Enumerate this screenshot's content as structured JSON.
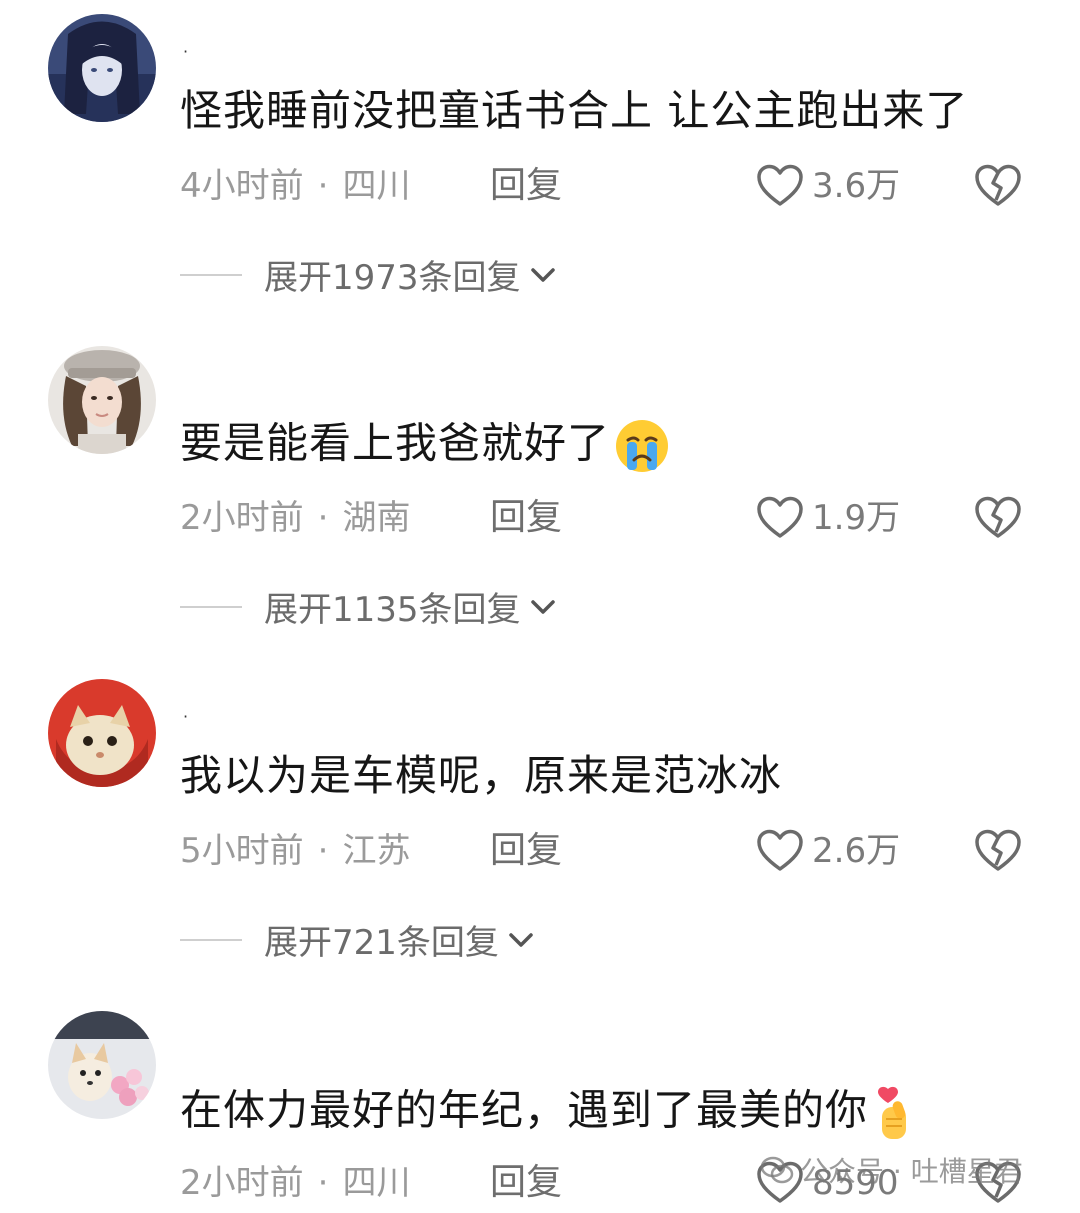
{
  "comments": [
    {
      "text": "怪我睡前没把童话书合上  让公主跑出来了",
      "time": "4小时前",
      "separator": "·",
      "location": "四川",
      "reply_label": "回复",
      "likes": "3.6万",
      "expand_label": "展开1973条回复",
      "avatar": "anime-girl-avatar"
    },
    {
      "text": "要是能看上我爸就好了",
      "emoji": "crying-emoji",
      "time": "2小时前",
      "separator": "·",
      "location": "湖南",
      "reply_label": "回复",
      "likes": "1.9万",
      "expand_label": "展开1135条回复",
      "avatar": "girl-with-cap-avatar"
    },
    {
      "text": "我以为是车模呢，原来是范冰冰",
      "time": "5小时前",
      "separator": "·",
      "location": "江苏",
      "reply_label": "回复",
      "likes": "2.6万",
      "expand_label": "展开721条回复",
      "avatar": "cat-avatar"
    },
    {
      "text": "在体力最好的年纪，遇到了最美的你",
      "emoji": "finger-heart-emoji",
      "time": "2小时前",
      "separator": "·",
      "location": "四川",
      "reply_label": "回复",
      "likes": "8590",
      "avatar": "dog-with-flowers-avatar"
    }
  ],
  "watermark": "公众号 · 吐槽星君",
  "colors": {
    "text": "#161616",
    "meta": "#9a9a9a",
    "reply": "#6e6e6e",
    "icon": "#6b6b6b"
  }
}
